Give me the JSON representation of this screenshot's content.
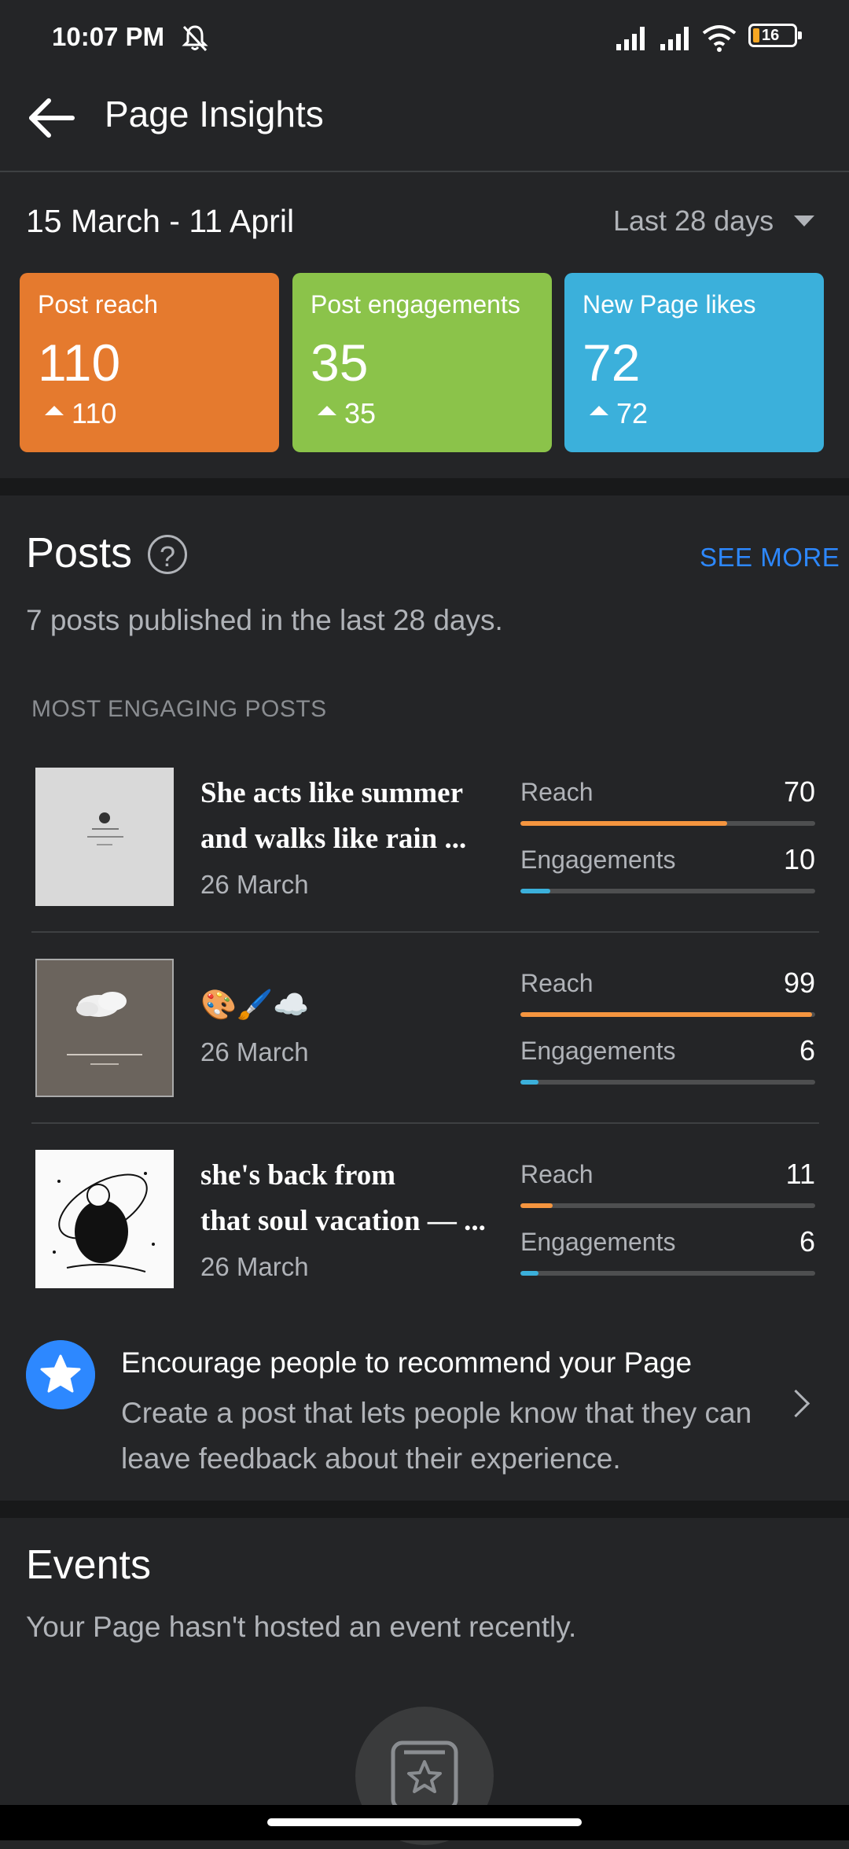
{
  "status_bar": {
    "time": "10:07 PM",
    "battery": "16"
  },
  "header": {
    "title": "Page Insights"
  },
  "date_row": {
    "range": "15 March - 11 April",
    "period": "Last 28 days"
  },
  "stats": [
    {
      "label": "Post reach",
      "value": "110",
      "delta": "110",
      "color": "#e57a2e"
    },
    {
      "label": "Post engagements",
      "value": "35",
      "delta": "35",
      "color": "#8bc34a"
    },
    {
      "label": "New Page likes",
      "value": "72",
      "delta": "72",
      "color": "#3bb0db"
    }
  ],
  "posts": {
    "title": "Posts",
    "help": "?",
    "see_more": "SEE MORE",
    "subtitle": "7 posts published in the last 28 days.",
    "section_label": "MOST ENGAGING POSTS",
    "items": [
      {
        "line1": "She acts like summer",
        "line2": "and walks like rain ...",
        "date": "26 March",
        "reach_label": "Reach",
        "reach": "70",
        "reach_fraction": 0.7,
        "eng_label": "Engagements",
        "engagements": "10",
        "eng_fraction": 0.1
      },
      {
        "line1": "🎨🖌️☁️",
        "line2": "",
        "date": "26 March",
        "reach_label": "Reach",
        "reach": "99",
        "reach_fraction": 0.99,
        "eng_label": "Engagements",
        "engagements": "6",
        "eng_fraction": 0.06
      },
      {
        "line1": "she's back from",
        "line2": "that soul vacation — ...",
        "date": "26 March",
        "reach_label": "Reach",
        "reach": "11",
        "reach_fraction": 0.11,
        "eng_label": "Engagements",
        "engagements": "6",
        "eng_fraction": 0.06
      }
    ]
  },
  "encourage": {
    "title": "Encourage people to recommend your Page",
    "body": "Create a post that lets people know that they can leave feedback about their experience."
  },
  "events": {
    "title": "Events",
    "subtitle": "Your Page hasn't hosted an event recently."
  },
  "colors": {
    "reach_bar": "#f5953f",
    "engagement_bar": "#3bb0db",
    "link": "#2d88ff"
  }
}
